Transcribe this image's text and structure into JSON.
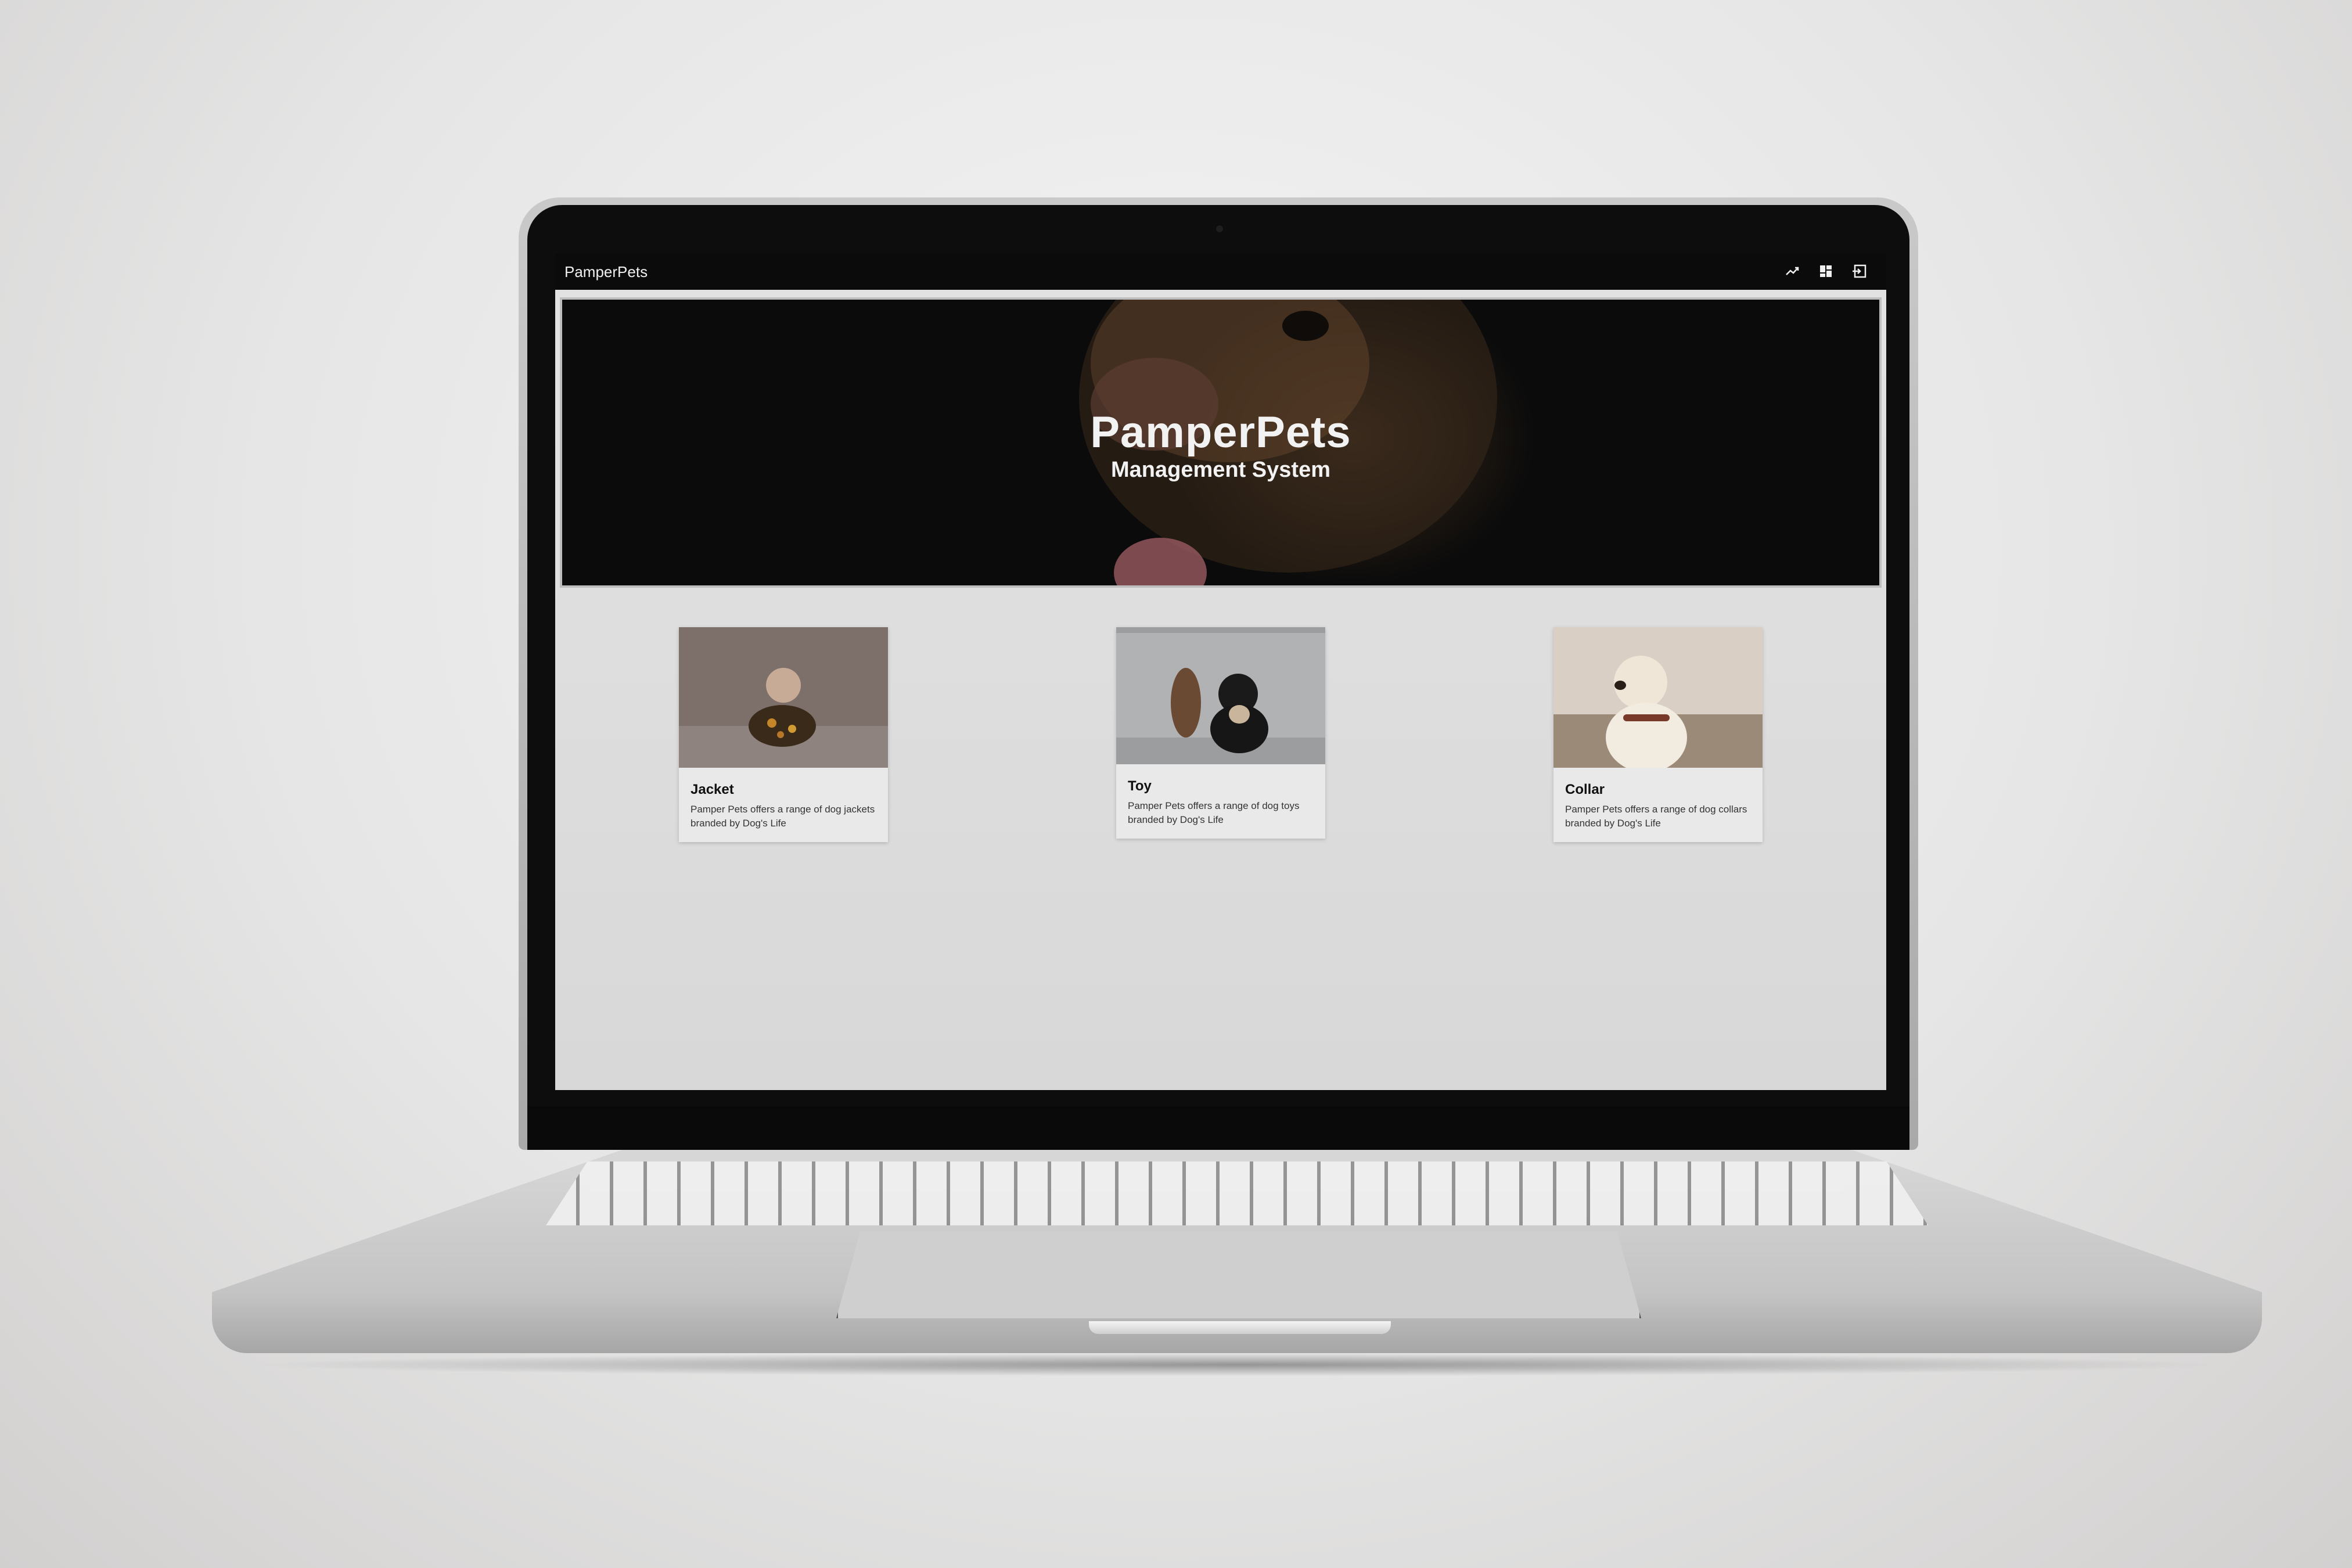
{
  "app": {
    "brand": "PamperPets"
  },
  "nav": {
    "icons": [
      "trending-up-icon",
      "dashboard-icon",
      "logout-icon"
    ]
  },
  "hero": {
    "title": "PamperPets",
    "subtitle": "Management System"
  },
  "cards": [
    {
      "title": "Jacket",
      "description": "Pamper Pets offers a range of dog jackets branded by Dog's Life"
    },
    {
      "title": "Toy",
      "description": "Pamper Pets offers a range of dog toys branded by Dog's Life"
    },
    {
      "title": "Collar",
      "description": "Pamper Pets offers a range of dog collars branded by Dog's Life"
    }
  ],
  "colors": {
    "topbar": "#0b0b0b",
    "hero_bg": "#0b0b0b",
    "page_bg": "#dcdcdc"
  }
}
